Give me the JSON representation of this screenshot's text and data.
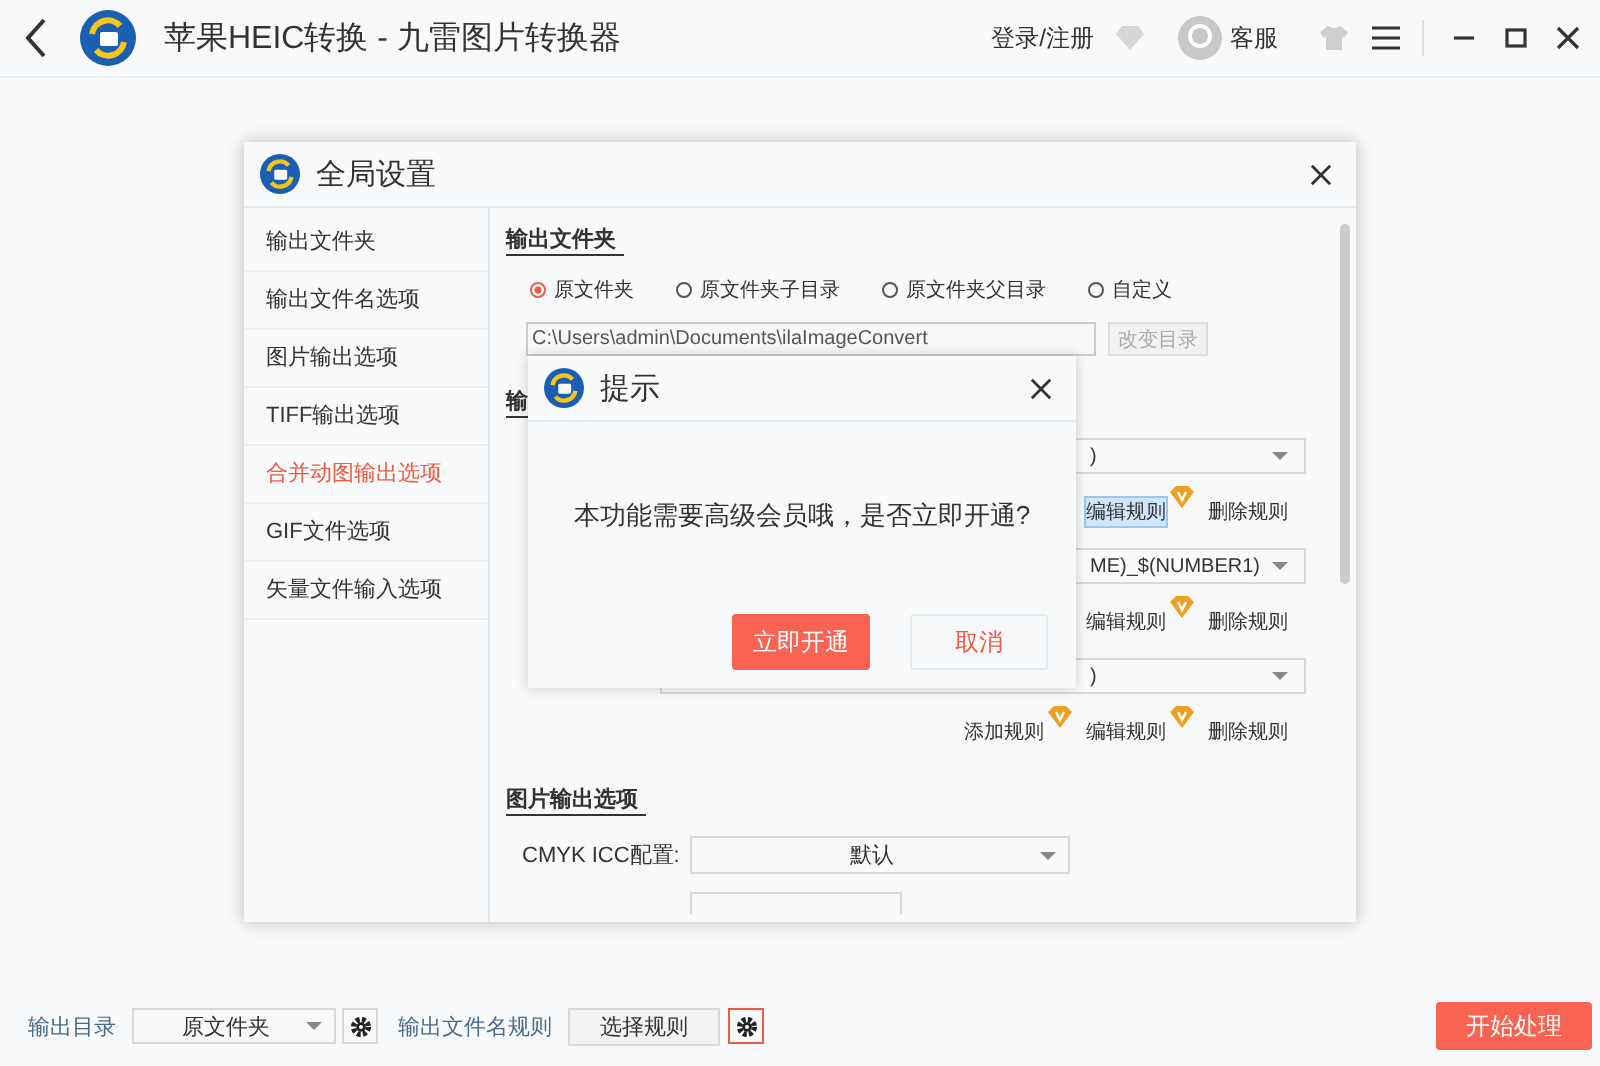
{
  "app": {
    "title": "苹果HEIC转换 - 九雷图片转换器",
    "login": "登录/注册",
    "service": "客服"
  },
  "settings": {
    "title": "全局设置",
    "nav": [
      {
        "label": "输出文件夹",
        "selected": false
      },
      {
        "label": "输出文件名选项",
        "selected": false
      },
      {
        "label": "图片输出选项",
        "selected": false
      },
      {
        "label": "TIFF输出选项",
        "selected": false
      },
      {
        "label": "合并动图输出选项",
        "selected": true
      },
      {
        "label": "GIF文件选项",
        "selected": false
      },
      {
        "label": "矢量文件输入选项",
        "selected": false
      }
    ],
    "output_folder": {
      "heading": "输出文件夹",
      "options": [
        {
          "label": "原文件夹",
          "selected": true
        },
        {
          "label": "原文件夹子目录",
          "selected": false
        },
        {
          "label": "原文件夹父目录",
          "selected": false
        },
        {
          "label": "自定义",
          "selected": false
        }
      ],
      "path": "C:\\Users\\admin\\Documents\\ilaImageConvert",
      "change_button": "改变目录"
    },
    "filename_options": {
      "heading": "输",
      "rules": [
        {
          "value": ")",
          "actions": [
            {
              "label": "编辑规则",
              "vip": true,
              "selected": true
            },
            {
              "label": "删除规则",
              "vip": false,
              "selected": false
            }
          ]
        },
        {
          "value": "ME)_$(NUMBER1)",
          "actions": [
            {
              "label": "编辑规则",
              "vip": true,
              "selected": false
            },
            {
              "label": "删除规则",
              "vip": false,
              "selected": false
            }
          ]
        },
        {
          "value": ")",
          "actions": [
            {
              "label": "添加规则",
              "vip": true,
              "selected": false
            },
            {
              "label": "编辑规则",
              "vip": true,
              "selected": false
            },
            {
              "label": "删除规则",
              "vip": false,
              "selected": false
            }
          ]
        }
      ]
    },
    "image_output": {
      "heading": "图片输出选项",
      "cmyk_label": "CMYK ICC配置:",
      "cmyk_value": "默认"
    }
  },
  "alert": {
    "title": "提示",
    "message": "本功能需要高级会员哦，是否立即开通?",
    "confirm": "立即开通",
    "cancel": "取消"
  },
  "bottom": {
    "output_dir_label": "输出目录",
    "output_dir_value": "原文件夹",
    "rule_label": "输出文件名规则",
    "rule_button": "选择规则",
    "start": "开始处理"
  }
}
